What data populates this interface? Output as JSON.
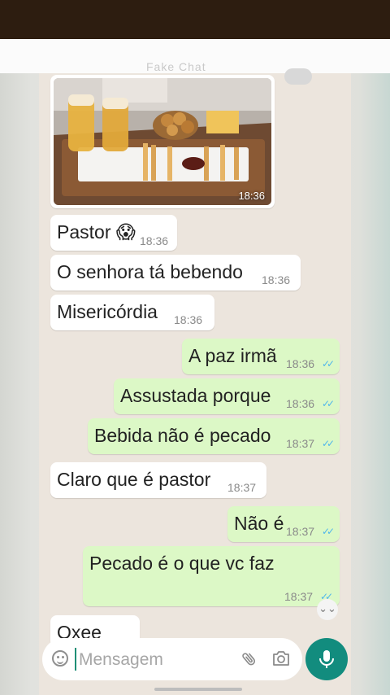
{
  "header": {
    "title": "Fake Chat"
  },
  "image_message": {
    "time": "18:36"
  },
  "messages": [
    {
      "dir": "in",
      "text": "Pastor 😱",
      "time": "18:36"
    },
    {
      "dir": "in",
      "text": "O senhora tá bebendo",
      "time": "18:36"
    },
    {
      "dir": "in",
      "text": "Misericórdia",
      "time": "18:36"
    },
    {
      "dir": "out",
      "text": "A paz irmã",
      "time": "18:36",
      "ticks": "✓✓"
    },
    {
      "dir": "out",
      "text": "Assustada porque",
      "time": "18:36",
      "ticks": "✓✓"
    },
    {
      "dir": "out",
      "text": "Bebida não é pecado",
      "time": "18:37",
      "ticks": "✓✓"
    },
    {
      "dir": "in",
      "text": "Claro que é pastor",
      "time": "18:37"
    },
    {
      "dir": "out",
      "text": "Não é",
      "time": "18:37",
      "ticks": "✓✓"
    },
    {
      "dir": "out",
      "text": "Pecado é o que vc faz",
      "time": "18:37",
      "ticks": "✓✓"
    },
    {
      "dir": "in",
      "text": "Oxee"
    }
  ],
  "scroll_button": {
    "icon": "double-chevron-down-icon",
    "glyph": "⌄⌄"
  },
  "composer": {
    "placeholder": "Mensagem"
  },
  "icons": {
    "emoji": "emoji-icon",
    "attach": "paperclip-icon",
    "camera": "camera-icon",
    "mic": "mic-icon"
  },
  "colors": {
    "incoming": "#ffffff",
    "outgoing": "#dcf8c6",
    "accent": "#128c7e",
    "tick": "#4fb6ec"
  }
}
